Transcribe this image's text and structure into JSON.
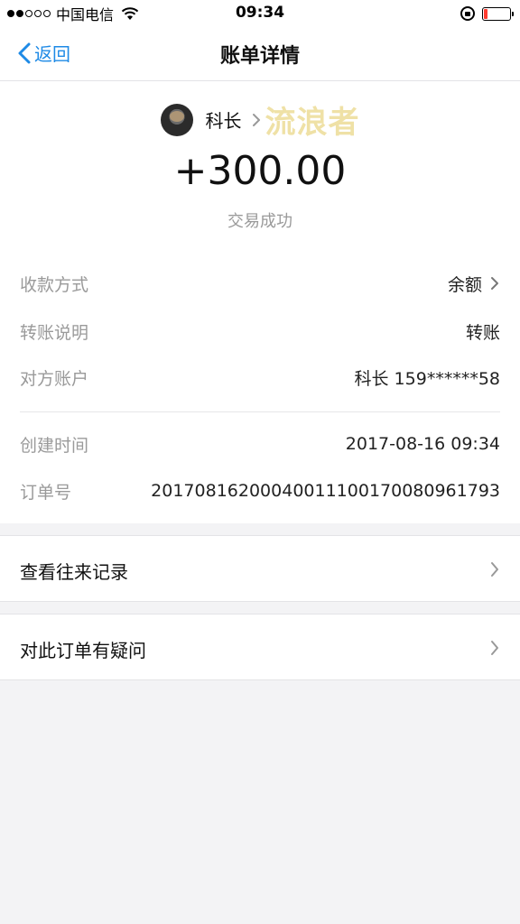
{
  "status_bar": {
    "carrier": "中国电信",
    "time": "09:34",
    "signal_bars": 2,
    "battery_level": 0.15
  },
  "nav": {
    "back_label": "返回",
    "title": "账单详情"
  },
  "counterparty": {
    "name": "科长",
    "watermark": "流浪者"
  },
  "amount": "+300.00",
  "status": "交易成功",
  "details": [
    {
      "label": "收款方式",
      "value": "余额",
      "has_chevron": true
    },
    {
      "label": "转账说明",
      "value": "转账"
    },
    {
      "label": "对方账户",
      "value": "科长 159******58"
    }
  ],
  "meta": [
    {
      "label": "创建时间",
      "value": "2017-08-16 09:34"
    },
    {
      "label": "订单号",
      "value": "20170816200040011100170080961793"
    }
  ],
  "actions": [
    {
      "label": "查看往来记录"
    },
    {
      "label": "对此订单有疑问"
    }
  ],
  "colors": {
    "accent": "#1e8ae6",
    "secondary_text": "#9a9a9a",
    "background": "#f3f3f5",
    "battery_low": "#ff3b30"
  },
  "icons": [
    "back-chevron-icon",
    "chevron-right-icon",
    "wifi-icon",
    "rotation-lock-icon",
    "battery-icon"
  ]
}
